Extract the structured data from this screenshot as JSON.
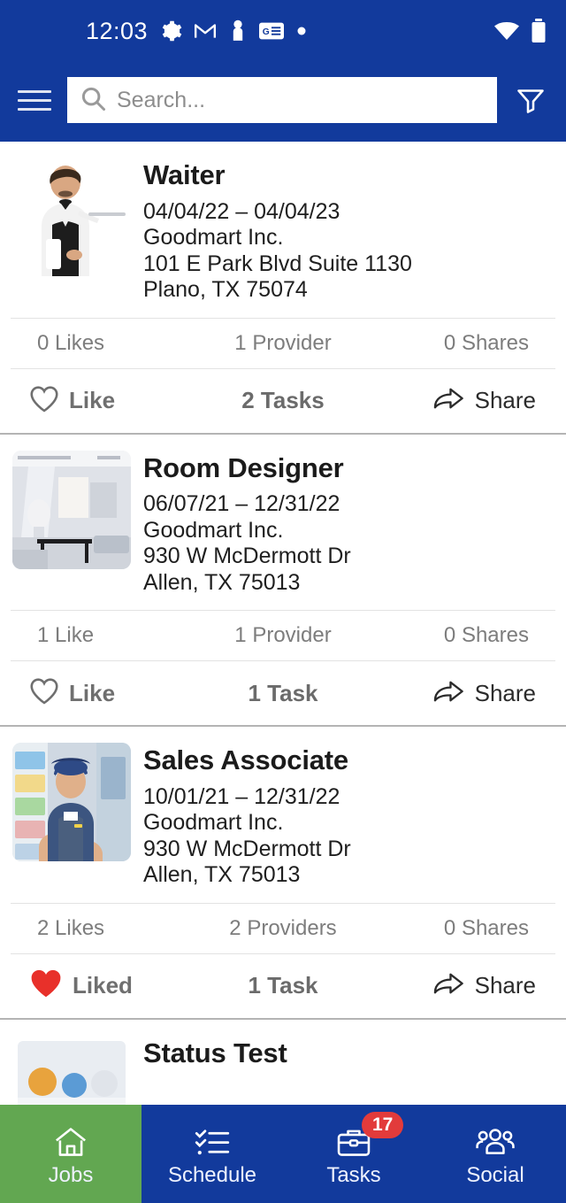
{
  "statusbar": {
    "time": "12:03",
    "icons": [
      "gear-icon",
      "gmail-icon",
      "person-icon",
      "google-news-icon",
      "dot-icon"
    ],
    "right_icons": [
      "wifi-icon",
      "battery-icon"
    ]
  },
  "appbar": {
    "menu_icon": "hamburger-menu-icon",
    "search_placeholder": "Search...",
    "search_value": "",
    "search_icon": "search-icon",
    "filter_icon": "filter-funnel-icon"
  },
  "theme": {
    "primary_blue": "#123a9c",
    "active_green": "#62a751",
    "badge_red": "#e23b3b",
    "liked_red": "#e8302a"
  },
  "jobs": [
    {
      "title": "Waiter",
      "dates": "04/04/22 – 04/04/23",
      "company": "Goodmart Inc.",
      "street": "101 E Park Blvd Suite 1130",
      "city": "Plano, TX 75074",
      "likes": "0 Likes",
      "providers": "1 Provider",
      "shares": "0 Shares",
      "like_label": "Like",
      "liked": false,
      "tasks": "2 Tasks",
      "share_label": "Share",
      "image": "waiter-photo"
    },
    {
      "title": "Room Designer",
      "dates": "06/07/21 – 12/31/22",
      "company": "Goodmart Inc.",
      "street": "930 W McDermott Dr",
      "city": "Allen, TX 75013",
      "likes": "1 Like",
      "providers": "1 Provider",
      "shares": "0 Shares",
      "like_label": "Like",
      "liked": false,
      "tasks": "1 Task",
      "share_label": "Share",
      "image": "room-interior-photo"
    },
    {
      "title": "Sales Associate",
      "dates": "10/01/21 – 12/31/22",
      "company": "Goodmart Inc.",
      "street": "930 W McDermott Dr",
      "city": "Allen, TX 75013",
      "likes": "2 Likes",
      "providers": "2 Providers",
      "shares": "0 Shares",
      "like_label": "Liked",
      "liked": true,
      "tasks": "1 Task",
      "share_label": "Share",
      "image": "sales-associate-photo"
    },
    {
      "title": "Status Test",
      "dates": "",
      "company": "",
      "street": "",
      "city": "",
      "likes": "",
      "providers": "",
      "shares": "",
      "like_label": "",
      "liked": false,
      "tasks": "",
      "share_label": "",
      "image": "status-test-photo"
    }
  ],
  "bottomnav": {
    "items": [
      {
        "label": "Jobs",
        "icon": "home-icon",
        "active": true,
        "badge": ""
      },
      {
        "label": "Schedule",
        "icon": "checklist-icon",
        "active": false,
        "badge": ""
      },
      {
        "label": "Tasks",
        "icon": "briefcase-icon",
        "active": false,
        "badge": "17"
      },
      {
        "label": "Social",
        "icon": "people-group-icon",
        "active": false,
        "badge": ""
      }
    ]
  }
}
